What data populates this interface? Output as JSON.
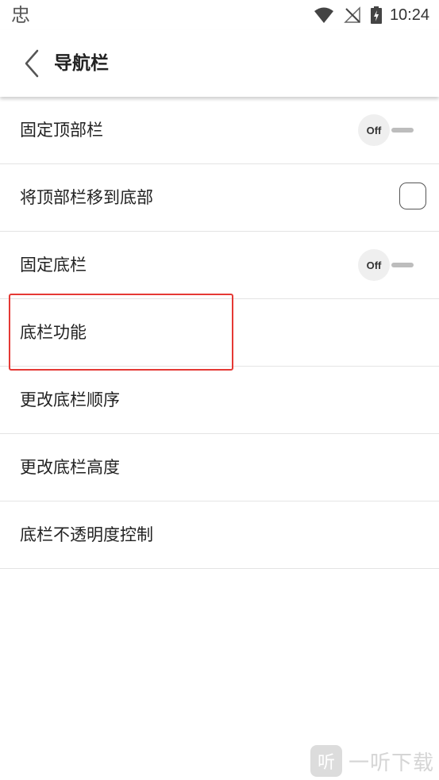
{
  "status_bar": {
    "app_icon_glyph": "忠",
    "time": "10:24",
    "icons": [
      "wifi-icon",
      "no-signal-icon",
      "battery-charging-icon"
    ]
  },
  "header": {
    "title": "导航栏",
    "back_icon": "chevron-left-icon"
  },
  "settings": [
    {
      "label": "固定顶部栏",
      "control": "toggle",
      "state": "Off"
    },
    {
      "label": "将顶部栏移到底部",
      "control": "checkbox",
      "checked": false
    },
    {
      "label": "固定底栏",
      "control": "toggle",
      "state": "Off"
    },
    {
      "label": "底栏功能",
      "control": "none"
    },
    {
      "label": "更改底栏顺序",
      "control": "none"
    },
    {
      "label": "更改底栏高度",
      "control": "none"
    },
    {
      "label": "底栏不透明度控制",
      "control": "none"
    }
  ],
  "highlight_color": "#e53935",
  "watermark": {
    "logo_glyph": "听",
    "text": "一听下载"
  }
}
